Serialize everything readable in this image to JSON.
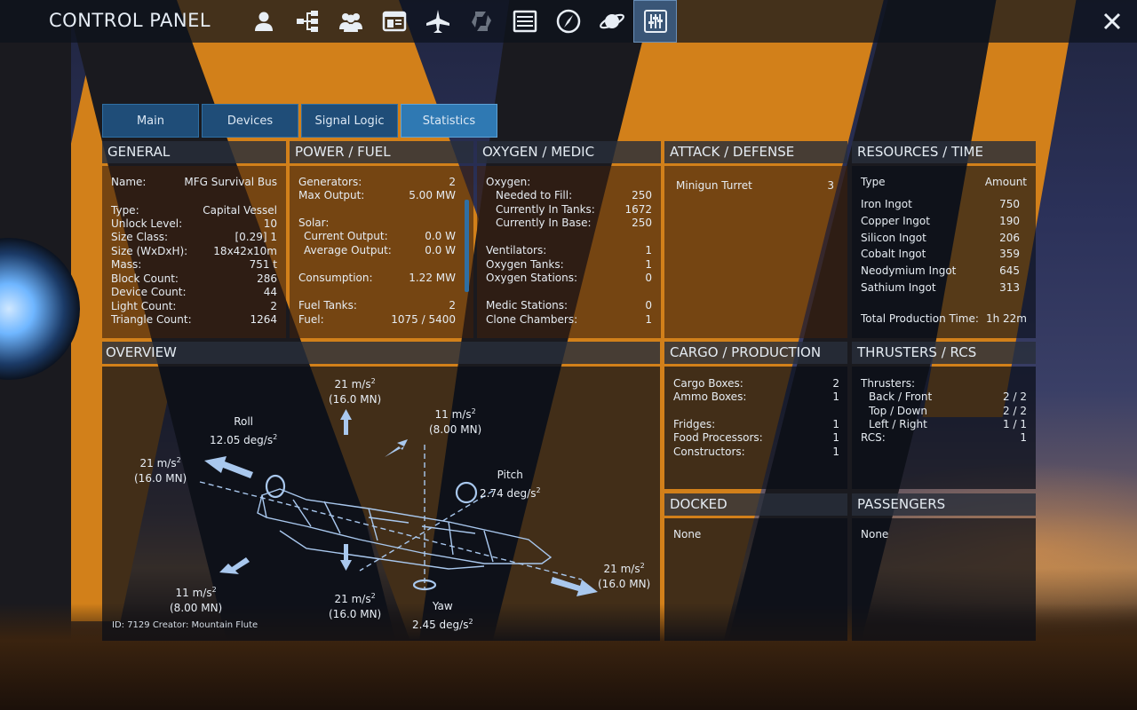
{
  "app": {
    "title": "CONTROL PANEL"
  },
  "nav_icons": [
    "person-icon",
    "structure-tree-icon",
    "group-icon",
    "window-icon",
    "ship-icon",
    "faction-icon",
    "list-icon",
    "compass-icon",
    "planet-icon",
    "control-sliders-icon"
  ],
  "tabs": [
    {
      "label": "Main"
    },
    {
      "label": "Devices"
    },
    {
      "label": "Signal Logic"
    },
    {
      "label": "Statistics"
    }
  ],
  "general": {
    "header": "GENERAL",
    "rows": [
      {
        "label": "Name:",
        "value": "MFG Survival Bus"
      },
      {
        "label": "Type:",
        "value": "Capital Vessel"
      },
      {
        "label": "Unlock Level:",
        "value": "10"
      },
      {
        "label": "Size Class:",
        "value": "[0.29]   1"
      },
      {
        "label": "Size (WxDxH):",
        "value": "18x42x10m"
      },
      {
        "label": "Mass:",
        "value": "751 t"
      },
      {
        "label": "Block Count:",
        "value": "286"
      },
      {
        "label": "Device Count:",
        "value": "44"
      },
      {
        "label": "Light Count:",
        "value": "2"
      },
      {
        "label": "Triangle Count:",
        "value": "1264"
      }
    ]
  },
  "power": {
    "header": "POWER / FUEL",
    "generators": {
      "label": "Generators:",
      "value": "2"
    },
    "max_output": {
      "label": "Max Output:",
      "value": "5.00 MW"
    },
    "solar": {
      "label": "Solar:"
    },
    "current_output": {
      "label": "Current Output:",
      "value": "0.0 W"
    },
    "average_output": {
      "label": "Average Output:",
      "value": "0.0 W"
    },
    "consumption": {
      "label": "Consumption:",
      "value": "1.22 MW"
    },
    "fuel_tanks": {
      "label": "Fuel Tanks:",
      "value": "2"
    },
    "fuel": {
      "label": "Fuel:",
      "value": "1075 / 5400"
    }
  },
  "oxygen": {
    "header": "OXYGEN / MEDIC",
    "oxygen": {
      "label": "Oxygen:"
    },
    "needed": {
      "label": "Needed to Fill:",
      "value": "250"
    },
    "in_tanks": {
      "label": "Currently In Tanks:",
      "value": "1672"
    },
    "in_base": {
      "label": "Currently In Base:",
      "value": "250"
    },
    "ventilators": {
      "label": "Ventilators:",
      "value": "1"
    },
    "oxygen_tanks": {
      "label": "Oxygen Tanks:",
      "value": "1"
    },
    "oxygen_stations": {
      "label": "Oxygen Stations:",
      "value": "0"
    },
    "medic_stations": {
      "label": "Medic Stations:",
      "value": "0"
    },
    "clone_chambers": {
      "label": "Clone Chambers:",
      "value": "1"
    }
  },
  "attack": {
    "header": "ATTACK / DEFENSE",
    "rows": [
      {
        "label": "Minigun Turret",
        "value": "3"
      }
    ]
  },
  "resources": {
    "header": "RESOURCES / TIME",
    "col_type": "Type",
    "col_amount": "Amount",
    "rows": [
      {
        "label": "Iron Ingot",
        "value": "750"
      },
      {
        "label": "Copper Ingot",
        "value": "190"
      },
      {
        "label": "Silicon Ingot",
        "value": "206"
      },
      {
        "label": "Cobalt Ingot",
        "value": "359"
      },
      {
        "label": "Neodymium Ingot",
        "value": "645"
      },
      {
        "label": "Sathium Ingot",
        "value": "313"
      }
    ],
    "total": {
      "label": "Total Production Time:",
      "value": "1h 22m"
    }
  },
  "overview": {
    "header": "OVERVIEW",
    "up": {
      "accel": "21 m/s",
      "force": "(16.0 MN)"
    },
    "forward_right": {
      "accel": "11 m/s",
      "force": "(8.00 MN)"
    },
    "left": {
      "accel": "21 m/s",
      "force": "(16.0 MN)"
    },
    "right": {
      "accel": "21 m/s",
      "force": "(16.0 MN)"
    },
    "down": {
      "accel": "21 m/s",
      "force": "(16.0 MN)"
    },
    "back_left": {
      "accel": "11 m/s",
      "force": "(8.00 MN)"
    },
    "roll": {
      "label": "Roll",
      "value": "12.05 deg/s"
    },
    "pitch": {
      "label": "Pitch",
      "value": "2.74 deg/s"
    },
    "yaw": {
      "label": "Yaw",
      "value": "2.45 deg/s"
    },
    "squared": "2",
    "id_creator": "ID: 7129  Creator: Mountain Flute"
  },
  "cargo": {
    "header": "CARGO / PRODUCTION",
    "rows": [
      {
        "label": "Cargo Boxes:",
        "value": "2"
      },
      {
        "label": "Ammo Boxes:",
        "value": "1"
      },
      {
        "label": "Fridges:",
        "value": "1"
      },
      {
        "label": "Food Processors:",
        "value": "1"
      },
      {
        "label": "Constructors:",
        "value": "1"
      }
    ]
  },
  "thrusters": {
    "header": "THRUSTERS / RCS",
    "thrusters": {
      "label": "Thrusters:"
    },
    "rows": [
      {
        "label": "Back / Front",
        "value": "2 / 2"
      },
      {
        "label": "Top / Down",
        "value": "2 / 2"
      },
      {
        "label": "Left / Right",
        "value": "1 / 1"
      }
    ],
    "rcs": {
      "label": "RCS:",
      "value": "1"
    }
  },
  "docked": {
    "header": "DOCKED",
    "value": "None"
  },
  "passengers": {
    "header": "PASSENGERS",
    "value": "None"
  }
}
